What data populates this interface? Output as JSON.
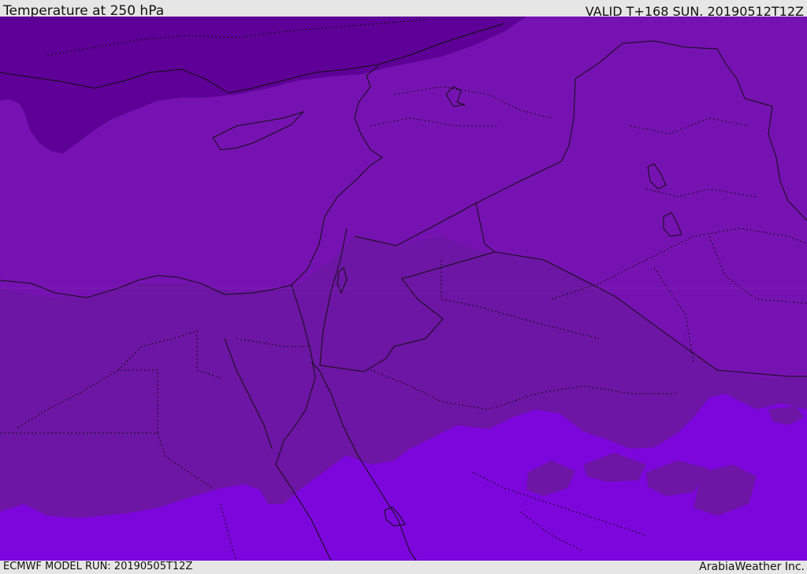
{
  "header": {
    "title": "Temperature at 250 hPa",
    "valid": "VALID T+168 SUN. 20190512T12Z"
  },
  "footer": {
    "model_run": "ECMWF MODEL RUN: 20190505T12Z",
    "credit": "ArabiaWeather Inc."
  },
  "colors": {
    "frame_background": "#e6e6e6",
    "band_coldest": "#5e0097",
    "band_cold": "#7612b2",
    "band_mid": "#6d15a4",
    "band_warm": "#7c06dc",
    "boundary_lines": "#111111"
  }
}
